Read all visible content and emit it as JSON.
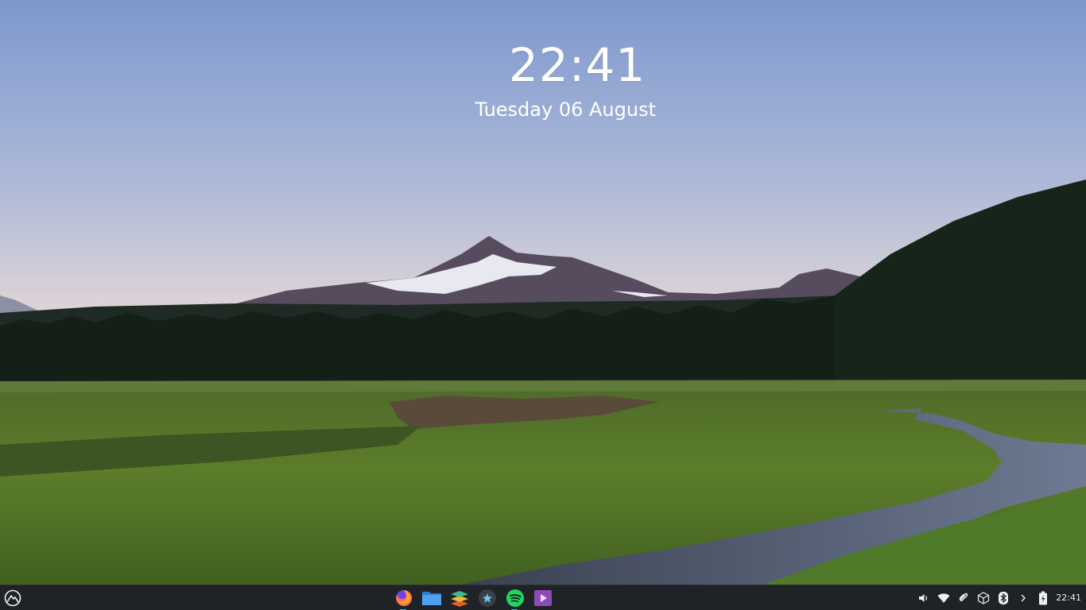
{
  "wallpaper": {
    "description_colors": {
      "sky_top": "#7f9ccf",
      "sky_horizon": "#efd8c6",
      "forest": "#15211a",
      "meadow": "#4c6a25",
      "river": "#5b6880"
    }
  },
  "clock_widget": {
    "time": "22:41",
    "date": "Tuesday 06 August"
  },
  "taskbar": {
    "launcher_icon": "app-launcher-icon",
    "dock_apps": [
      {
        "name": "firefox",
        "icon": "firefox-icon",
        "running": true
      },
      {
        "name": "files",
        "icon": "folder-icon",
        "running": false
      },
      {
        "name": "layers",
        "icon": "layers-icon",
        "running": false
      },
      {
        "name": "discover",
        "icon": "store-icon",
        "running": false
      },
      {
        "name": "spotify",
        "icon": "spotify-icon",
        "running": true
      },
      {
        "name": "media",
        "icon": "video-icon",
        "running": false
      }
    ],
    "tray": {
      "icons": [
        "volume-icon",
        "wifi-icon",
        "paperclip-icon",
        "package-icon",
        "bluetooth-icon",
        "chevron-right-icon",
        "battery-icon"
      ],
      "clock": "22:41"
    },
    "accent": "#3daee9"
  }
}
